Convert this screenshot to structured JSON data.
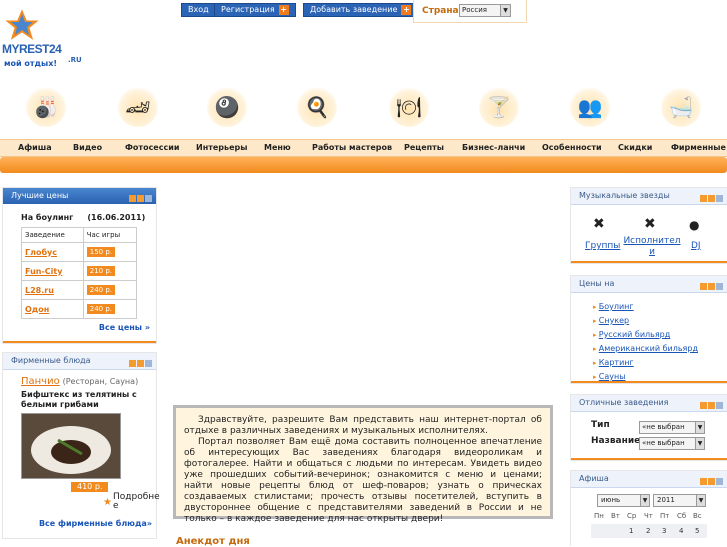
{
  "header": {
    "login_label": "Вход",
    "register_label": "Регистрация",
    "add_place_label": "Добавить заведение",
    "country_label": "Страна",
    "country_value": "Россия",
    "logo_text": "MYREST24",
    "logo_domain": ".RU",
    "logo_tagline": "мой отдых!"
  },
  "menu": [
    "Афиша",
    "Видео",
    "Фотосессии",
    "Интерьеры",
    "Меню",
    "Работы мастеров",
    "Рецепты",
    "Бизнес-ланчи",
    "Особенности",
    "Скидки",
    "Фирменные"
  ],
  "best_prices": {
    "title": "Лучшие цены",
    "subtitle": "На боулинг",
    "date": "(16.06.2011)",
    "col_place": "Заведение",
    "col_hour": "Час игры",
    "rows": [
      {
        "name": "Глобус",
        "price": "150 р."
      },
      {
        "name": "Fun-City",
        "price": "210 р."
      },
      {
        "name": "L28.ru",
        "price": "240 р."
      },
      {
        "name": "Одон",
        "price": "240 р."
      }
    ],
    "all_prices": "Все цены »"
  },
  "signature": {
    "title": "Фирменные блюда",
    "place": "Панчио",
    "place_type": "(Ресторан, Сауна)",
    "dish": "Бифштекс из телятины с белыми грибами",
    "price": "410 р.",
    "more": "Подробне е",
    "all": "Все фирменные блюда»"
  },
  "welcome": {
    "p1": "Здравствуйте, разрешите Вам представить наш интернет-портал об отдыхе в различных заведениях и музыкальных исполнителях.",
    "p2": "Портал позволяет Вам ещё дома составить полноценное впечатление об интересующих Вас заведениях благодаря видеороликам и фотогалерее. Найти и общаться с людьми по интересам. Увидеть видео уже прошедших событий-вечеринок; ознакомится с меню и ценами; найти новые рецепты блюд от шеф-поваров; узнать о прическах создаваемых стилистами; прочесть отзывы посетителей, вступить в двустороннее общение с представителями заведений в России и не только – в каждое заведение для нас открыты двери!"
  },
  "bottom_heading": "Анекдот дня",
  "music": {
    "title": "Музыкальные звезды",
    "items": [
      "Группы",
      "Исполнители",
      "DJ"
    ]
  },
  "prices_on": {
    "title": "Цены на",
    "items": [
      "Боулинг",
      "Снукер",
      "Русский бильярд",
      "Американский бильярд",
      "Картинг",
      "Сауны"
    ]
  },
  "excellent": {
    "title": "Отличные заведения",
    "type_label": "Тип",
    "name_label": "Название",
    "not_selected": "«не выбран"
  },
  "afisha": {
    "title": "Афиша",
    "month": "июнь",
    "year": "2011",
    "weekdays": [
      "Пн",
      "Вт",
      "Ср",
      "Чт",
      "Пт",
      "Сб",
      "Вс"
    ],
    "days": [
      "1",
      "2",
      "3",
      "4",
      "5"
    ]
  },
  "colors": {
    "accent_orange": "#f28a1e",
    "brand_blue": "#2a62b2"
  }
}
